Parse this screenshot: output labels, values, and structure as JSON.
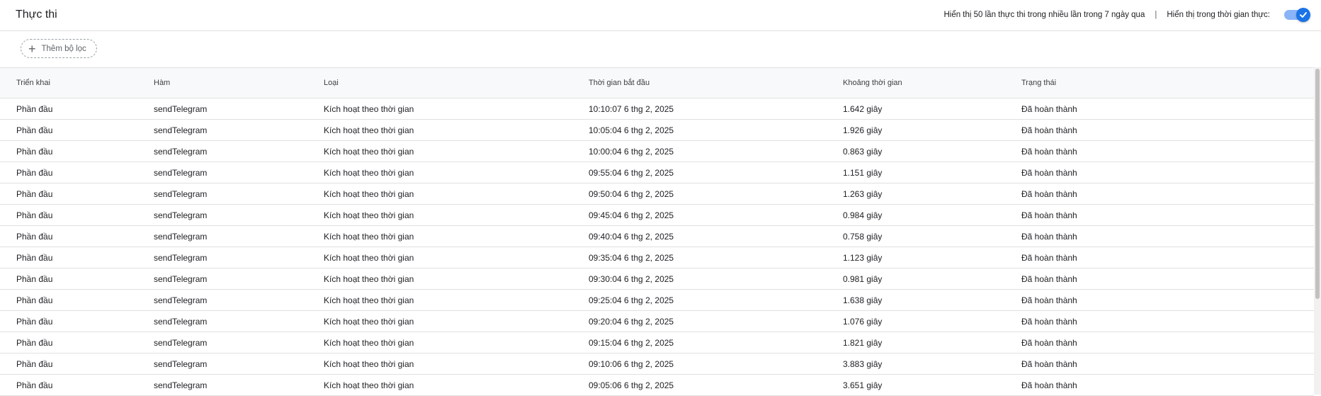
{
  "header": {
    "title": "Thực thi",
    "info_text": "Hiển thị 50 lần thực thi trong nhiều lần trong 7 ngày qua",
    "separator": "|",
    "realtime_label": "Hiển thị trong thời gian thực:",
    "realtime_enabled": true
  },
  "filter": {
    "add_label": "Thêm bộ lọc"
  },
  "table": {
    "columns": [
      "Triển khai",
      "Hàm",
      "Loại",
      "Thời gian bắt đầu",
      "Khoảng thời gian",
      "Trạng thái"
    ],
    "rows": [
      [
        "Phần đầu",
        "sendTelegram",
        "Kích hoạt theo thời gian",
        "10:10:07 6 thg 2, 2025",
        "1.642 giây",
        "Đã hoàn thành"
      ],
      [
        "Phần đầu",
        "sendTelegram",
        "Kích hoạt theo thời gian",
        "10:05:04 6 thg 2, 2025",
        "1.926 giây",
        "Đã hoàn thành"
      ],
      [
        "Phần đầu",
        "sendTelegram",
        "Kích hoạt theo thời gian",
        "10:00:04 6 thg 2, 2025",
        "0.863 giây",
        "Đã hoàn thành"
      ],
      [
        "Phần đầu",
        "sendTelegram",
        "Kích hoạt theo thời gian",
        "09:55:04 6 thg 2, 2025",
        "1.151 giây",
        "Đã hoàn thành"
      ],
      [
        "Phần đầu",
        "sendTelegram",
        "Kích hoạt theo thời gian",
        "09:50:04 6 thg 2, 2025",
        "1.263 giây",
        "Đã hoàn thành"
      ],
      [
        "Phần đầu",
        "sendTelegram",
        "Kích hoạt theo thời gian",
        "09:45:04 6 thg 2, 2025",
        "0.984 giây",
        "Đã hoàn thành"
      ],
      [
        "Phần đầu",
        "sendTelegram",
        "Kích hoạt theo thời gian",
        "09:40:04 6 thg 2, 2025",
        "0.758 giây",
        "Đã hoàn thành"
      ],
      [
        "Phần đầu",
        "sendTelegram",
        "Kích hoạt theo thời gian",
        "09:35:04 6 thg 2, 2025",
        "1.123 giây",
        "Đã hoàn thành"
      ],
      [
        "Phần đầu",
        "sendTelegram",
        "Kích hoạt theo thời gian",
        "09:30:04 6 thg 2, 2025",
        "0.981 giây",
        "Đã hoàn thành"
      ],
      [
        "Phần đầu",
        "sendTelegram",
        "Kích hoạt theo thời gian",
        "09:25:04 6 thg 2, 2025",
        "1.638 giây",
        "Đã hoàn thành"
      ],
      [
        "Phần đầu",
        "sendTelegram",
        "Kích hoạt theo thời gian",
        "09:20:04 6 thg 2, 2025",
        "1.076 giây",
        "Đã hoàn thành"
      ],
      [
        "Phần đầu",
        "sendTelegram",
        "Kích hoạt theo thời gian",
        "09:15:04 6 thg 2, 2025",
        "1.821 giây",
        "Đã hoàn thành"
      ],
      [
        "Phần đầu",
        "sendTelegram",
        "Kích hoạt theo thời gian",
        "09:10:06 6 thg 2, 2025",
        "3.883 giây",
        "Đã hoàn thành"
      ],
      [
        "Phần đầu",
        "sendTelegram",
        "Kích hoạt theo thời gian",
        "09:05:06 6 thg 2, 2025",
        "3.651 giây",
        "Đã hoàn thành"
      ]
    ]
  },
  "icons": {
    "add": "plus-icon",
    "toggle_check": "check-icon"
  },
  "colors": {
    "accent": "#1a73e8",
    "toggle_track": "#8ab4f8",
    "header_bg": "#f8f9fa",
    "divider": "#e0e0e0"
  }
}
